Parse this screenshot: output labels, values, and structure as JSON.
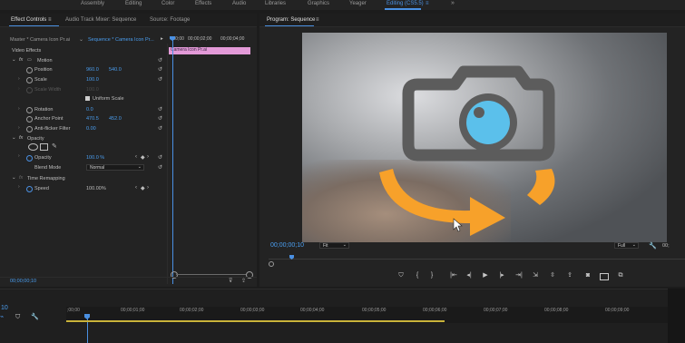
{
  "workspaces": {
    "items": [
      "Assembly",
      "Editing",
      "Color",
      "Effects",
      "Audio",
      "Libraries",
      "Graphics",
      "Yeager",
      "Editing (CS5.5)"
    ],
    "active_index": 8,
    "more_glyph": "»"
  },
  "effect_controls": {
    "tabs": [
      "Effect Controls",
      "Audio Track Mixer: Sequence",
      "Source: Footage"
    ],
    "menu_glyph": "≡",
    "master_label": "Master * Camera Icon Pr.ai",
    "sequence_label": "Sequence * Camera Icon Pr...",
    "ruler_times": [
      ";00;00",
      "00;00;02;00",
      "00;00;04;00"
    ],
    "clip_name": "Camera Icon Pr.ai",
    "section_label": "Video Effects",
    "motion": {
      "label": "Motion",
      "position_label": "Position",
      "position_x": "960.0",
      "position_y": "540.0",
      "scale_label": "Scale",
      "scale_value": "100.0",
      "scale_width_label": "Scale Width",
      "scale_width_value": "100.0",
      "uniform_label": "Uniform Scale",
      "rotation_label": "Rotation",
      "rotation_value": "0.0",
      "anchor_label": "Anchor Point",
      "anchor_x": "470.5",
      "anchor_y": "452.0",
      "antiflicker_label": "Anti-flicker Filter",
      "antiflicker_value": "0.00"
    },
    "opacity": {
      "label": "Opacity",
      "opacity_label": "Opacity",
      "opacity_value": "100.0 %",
      "blend_label": "Blend Mode",
      "blend_value": "Normal"
    },
    "time_remapping": {
      "label": "Time Remapping",
      "speed_label": "Speed",
      "speed_value": "100.00%"
    },
    "bottom_timecode": "00;00;00;10"
  },
  "program_monitor": {
    "tab": "Program: Sequence",
    "menu_glyph": "≡",
    "timecode": "00;00;00;10",
    "fit_value": "Fit",
    "full_value": "Full",
    "duration_partial": "00;"
  },
  "timeline": {
    "current": "10",
    "ruler": [
      ";00;00",
      "00;00;01;00",
      "00;00;02;00",
      "00;00;03;00",
      "00;00;04;00",
      "00;00;05;00",
      "00;00;06;00",
      "00;00;07;00",
      "00;00;08;00",
      "00;00;09;00"
    ]
  },
  "colors": {
    "accent": "#4a90e2",
    "clip_pink": "#e39ad8",
    "camera_gray": "#5c5c5c",
    "lens_blue": "#5bc0eb",
    "arrow_orange": "#f7a12a",
    "work_area_yellow": "#c9b23a"
  }
}
